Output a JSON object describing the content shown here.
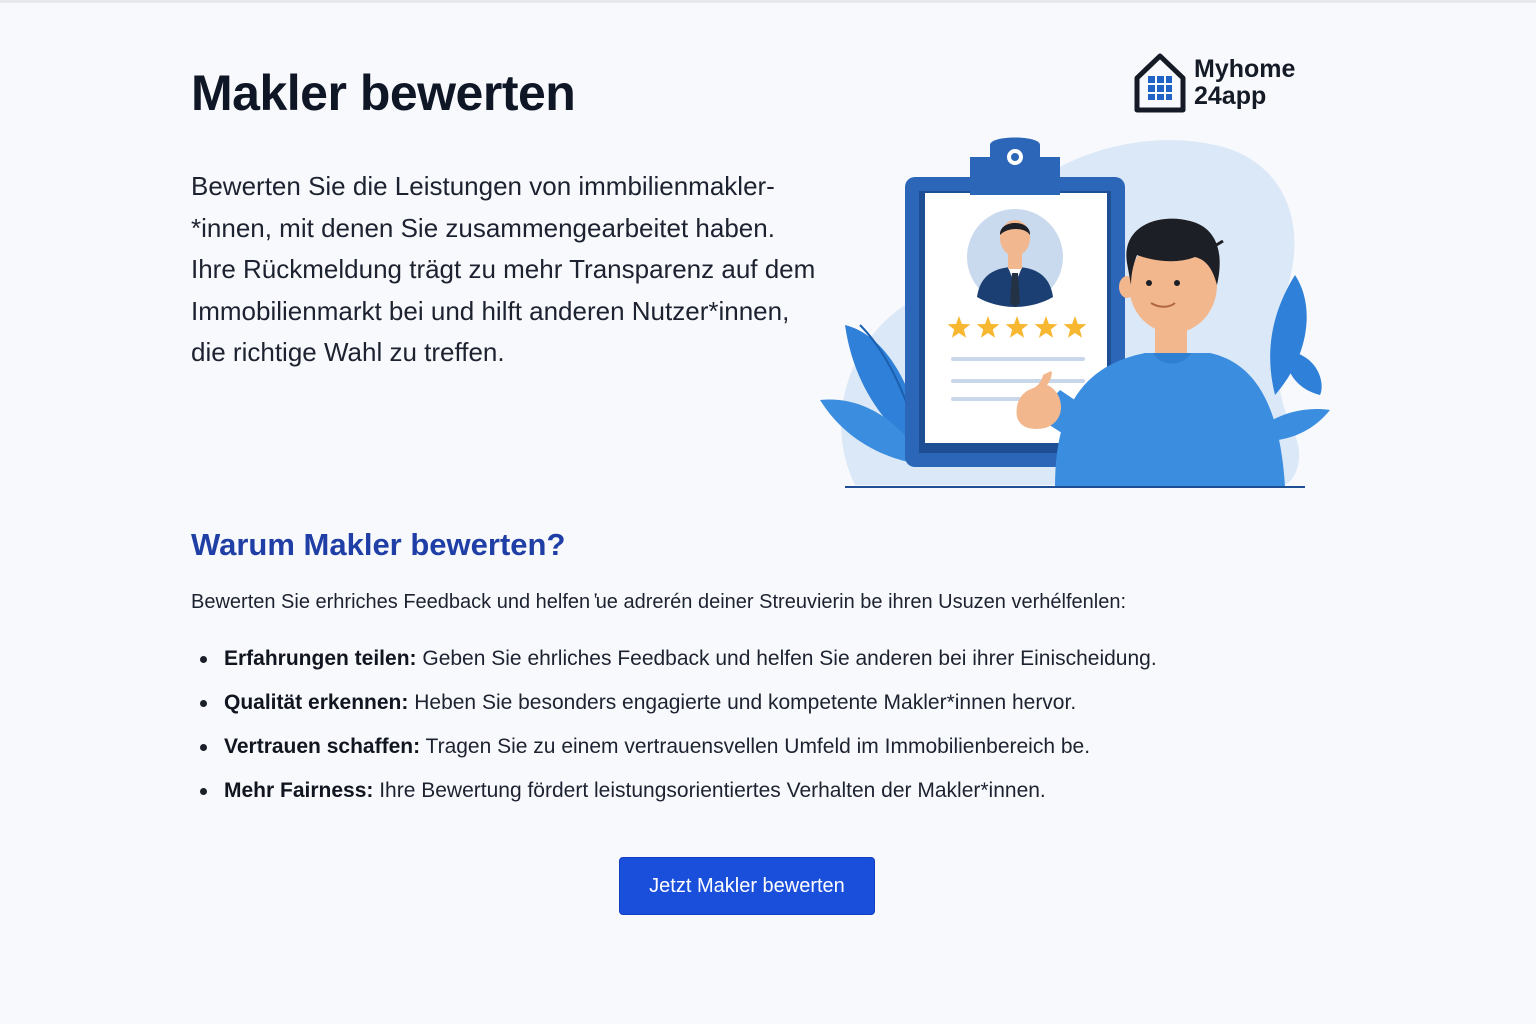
{
  "header": {
    "title": "Makler bewerten",
    "logo_line1": "Myhome",
    "logo_line2": "24app"
  },
  "intro": {
    "text": "Bewerten Sie die Leistungen von immbilienmakler-*innen, mit denen Sie zusammengearbeitet haben. Ihre Rückmeldung trägt zu mehr Transparenz auf dem Immobilienmarkt bei und hilft anderen Nutzer*innen, die richtige Wahl zu treffen."
  },
  "illustration": {
    "icons": [
      "clipboard-icon",
      "agent-avatar-icon",
      "star-icon",
      "thumbs-up-person-icon",
      "leaf-icon"
    ],
    "rating_stars": 5,
    "colors": {
      "primary_blue": "#2c66b8",
      "light_blue": "#dbe8f7",
      "star": "#f7b731",
      "shirt": "#3b8de0"
    }
  },
  "why": {
    "title": "Warum Makler bewerten?",
    "lead": "Bewerten Sie erhriches Feedback und helfen ̔ue adrerén deiner Streuvierin be ihren Usuzen verhélfenlen:",
    "items": [
      {
        "label": "Erfahrungen teilen:",
        "text": " Geben Sie ehrliches Feedback und helfen Sie anderen bei ihrer Einischeidung."
      },
      {
        "label": "Qualität erkennen:",
        "text": " Heben Sie besonders engagierte und kompetente Makler*innen hervor."
      },
      {
        "label": "Vertrauen schaffen:",
        "text": " Tragen Sie zu einem vertrauensvellen Umfeld im Immobilienbereich be."
      },
      {
        "label": "Mehr Fairness:",
        "text": " Ihre Bewertung fördert leistungsorientiertes Verhalten der Makler*innen."
      }
    ]
  },
  "cta": {
    "label": "Jetzt Makler bewerten"
  },
  "colors": {
    "background": "#f8f9fc",
    "heading_accent": "#1f3fa6",
    "button": "#1a4fdb"
  }
}
